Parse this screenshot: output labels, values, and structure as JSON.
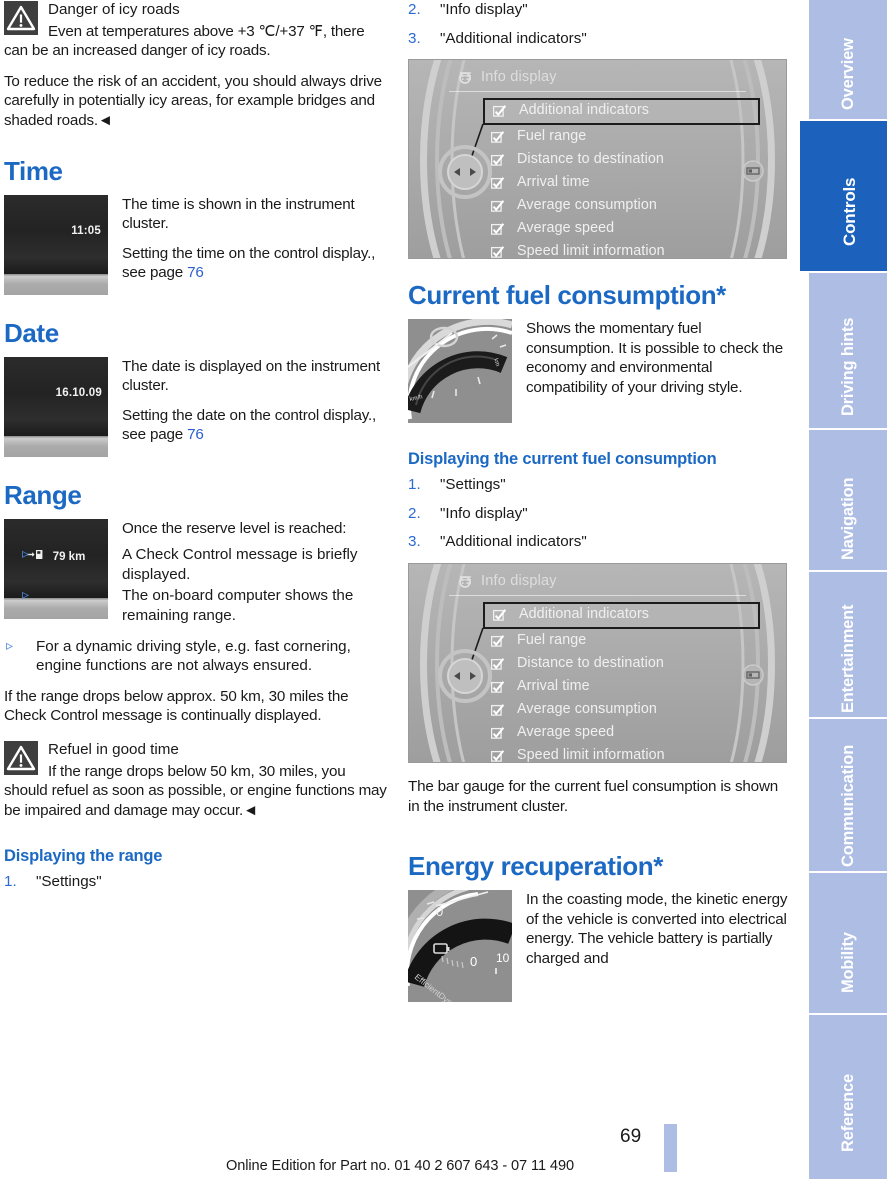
{
  "page": {
    "number": "69",
    "footnote": "Online Edition for Part no. 01 40 2 607 643 - 07 11 490"
  },
  "left_column": {
    "warning_icy": {
      "icon": "warning-triangle-icon",
      "title": "Danger of icy roads",
      "body": "Even at temperatures above +3 ℃/+37 ℉, there can be an increased danger of icy roads."
    },
    "icy_paragraph": "To reduce the risk of an accident, you should always drive carefully in potentially icy areas, for example bridges and shaded roads.◄",
    "time_section": {
      "heading": "Time",
      "cluster_value": "11:05",
      "paragraphs": [
        "The time is shown in the instrument cluster.",
        "Setting the time on the control display., see page "
      ],
      "page_ref": "76"
    },
    "date_section": {
      "heading": "Date",
      "cluster_value": "16.10.09",
      "paragraphs": [
        "The date is displayed on the instrument cluster.",
        "Setting the date on the control display., see page "
      ],
      "page_ref": "76"
    },
    "range_section": {
      "heading": "Range",
      "cluster_value": "79 km",
      "cluster_icon": "fuel-pump-icon",
      "intro": "Once the reserve level is reached:",
      "bullets": [
        "A Check Control message is briefly displayed.",
        "The on-board computer shows the remaining range."
      ],
      "bullets2": [
        "For a dynamic driving style, e.g. fast cornering, engine functions are not always ensured."
      ],
      "paragraph": "If the range drops below approx. 50 km, 30 miles the Check Control message is continually displayed.",
      "warning": {
        "icon": "warning-triangle-icon",
        "title": "Refuel in good time",
        "body": "If the range drops below 50 km, 30 miles, you should refuel as soon as possible, or engine functions may be impaired and damage may occur.◄"
      },
      "sub_heading": "Displaying the range",
      "steps": [
        "\"Settings\""
      ]
    }
  },
  "right_column": {
    "range_steps_continued": [
      "\"Info display\"",
      "\"Additional indicators\""
    ],
    "info_display_menu": {
      "title": "Info display",
      "title_icon": "gear-settings-icon",
      "items": [
        {
          "label": "Additional indicators",
          "checked": true,
          "selected": true
        },
        {
          "label": "Fuel range",
          "checked": true,
          "selected": false
        },
        {
          "label": "Distance to destination",
          "checked": true,
          "selected": false
        },
        {
          "label": "Arrival time",
          "checked": true,
          "selected": false
        },
        {
          "label": "Average consumption",
          "checked": true,
          "selected": false
        },
        {
          "label": "Average speed",
          "checked": true,
          "selected": false
        },
        {
          "label": "Speed limit information",
          "checked": true,
          "selected": false
        }
      ]
    },
    "fuel_consumption_section": {
      "heading": "Current fuel consumption*",
      "paragraph": "Shows the momentary fuel consumption. It is possible to check the economy and environmental compatibility of your driving style.",
      "sub_heading": "Displaying the current fuel consumption",
      "steps": [
        "\"Settings\"",
        "\"Info display\"",
        "\"Additional indicators\""
      ],
      "closing_paragraph": "The bar gauge for the current fuel consumption is shown in the instrument cluster."
    },
    "energy_recuperation_section": {
      "heading": "Energy recuperation*",
      "paragraph": "In the coasting mode, the kinetic energy of the vehicle is converted into electrical energy. The vehicle battery is partially charged and",
      "gauge_labels": {
        "brand": "EfficientDynamics",
        "zero": "0",
        "ten": "10"
      }
    }
  },
  "nav_rail": {
    "tabs": [
      {
        "label": "Overview",
        "active": false
      },
      {
        "label": "Controls",
        "active": true
      },
      {
        "label": "Driving hints",
        "active": false
      },
      {
        "label": "Navigation",
        "active": false
      },
      {
        "label": "Entertainment",
        "active": false
      },
      {
        "label": "Communication",
        "active": false
      },
      {
        "label": "Mobility",
        "active": false
      },
      {
        "label": "Reference",
        "active": false
      }
    ]
  },
  "colors": {
    "heading_blue": "#1c69c4",
    "tab_inactive": "#aebde4",
    "tab_active": "#1c62bd",
    "link_blue": "#2b5fcf"
  }
}
